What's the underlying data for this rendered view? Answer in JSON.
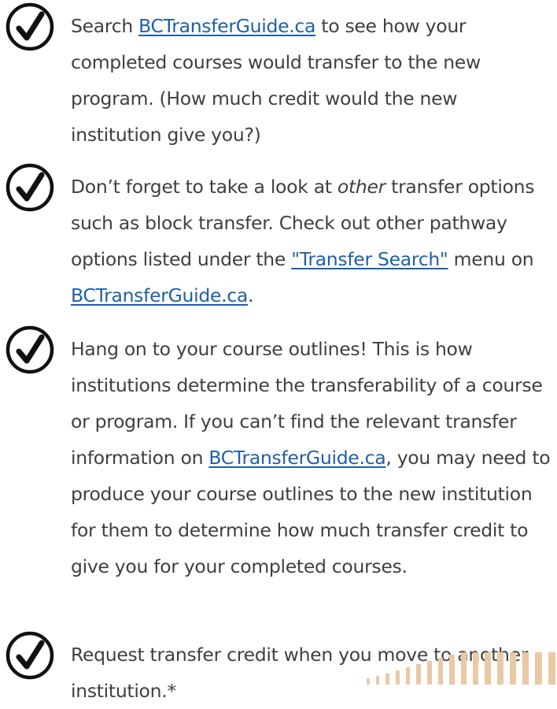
{
  "icons": {
    "check": "check-circle-icon"
  },
  "colors": {
    "text": "#3f3f3f",
    "link": "#1f5fa8",
    "icon": "#111111",
    "stripe": "#e9c9a6"
  },
  "items": [
    {
      "p1": "Search ",
      "link1": "BCTransferGuide.ca",
      "p2": " to see how your completed courses would transfer to the new program. (How much credit would the new institution give you?)"
    },
    {
      "p1": "Don’t forget to take a look at ",
      "em": "other",
      "p2": " transfer options such as block transfer. Check out other pathway options listed under the ",
      "link1": "\"Transfer Search\"",
      "p3": " menu on ",
      "link2": "BCTransferGuide.ca",
      "p4": "."
    },
    {
      "p1": "Hang on to your course outlines! This is how institutions determine the transferability of a course or program. If you can’t find the relevant transfer information on ",
      "link1": "BCTransferGuide.ca",
      "p2": ", you may need to produce your course outlines to the new institution for them to determine how much transfer credit to give you for your completed courses."
    },
    {
      "p1": "Request transfer credit when you move to another institution.*"
    }
  ]
}
